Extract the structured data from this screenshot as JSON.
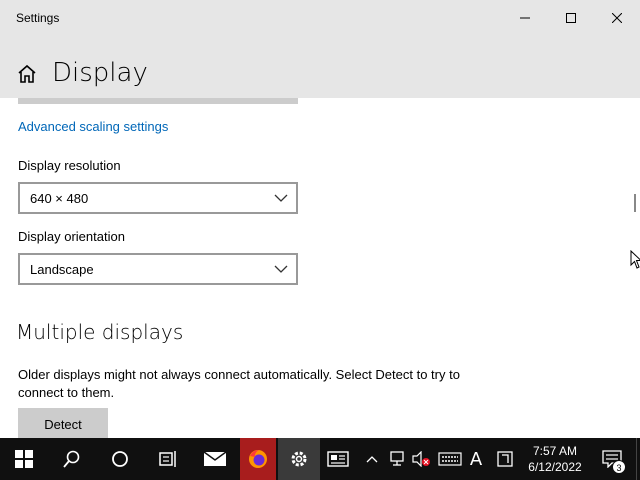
{
  "window": {
    "title": "Settings",
    "controls": {
      "minimize": "minimize",
      "maximize": "maximize",
      "close": "close"
    }
  },
  "header": {
    "home_icon": "home-icon",
    "title": "Display"
  },
  "content": {
    "advanced_link": "Advanced scaling settings",
    "resolution": {
      "label": "Display resolution",
      "value": "640 × 480"
    },
    "orientation": {
      "label": "Display orientation",
      "value": "Landscape"
    },
    "multiple": {
      "heading": "Multiple displays",
      "description": "Older displays might not always connect automatically. Select Detect to try to connect to them.",
      "detect_label": "Detect"
    }
  },
  "taskbar": {
    "icons": [
      "windows-start-icon",
      "search-icon",
      "cortana-icon",
      "task-view-icon",
      "mail-icon",
      "firefox-icon",
      "settings-gear-icon",
      "news-icon"
    ],
    "tray": {
      "ime_label": "A",
      "time": "7:57 AM",
      "date": "6/12/2022",
      "notification_count": "3"
    }
  },
  "colors": {
    "accent_link": "#0067b8",
    "title_bg": "#e6e6e6",
    "taskbar_bg": "#101010",
    "firefox_highlight": "#a81d1d"
  }
}
